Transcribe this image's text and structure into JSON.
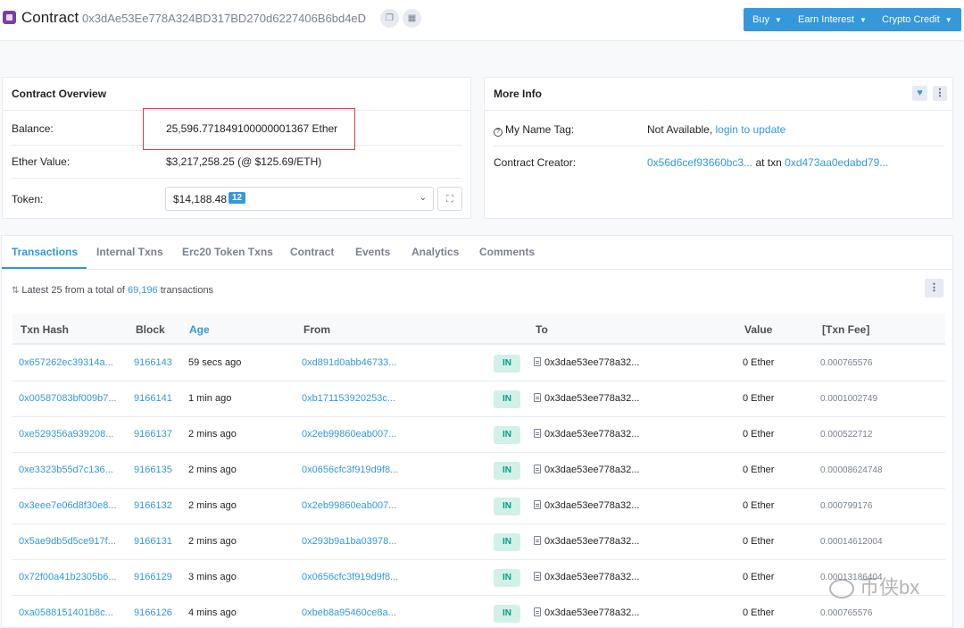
{
  "header": {
    "title": "Contract",
    "address": "0x3dAe53Ee778A324BD317BD270d6227406B6bd4eD",
    "buttons": [
      {
        "label": "Buy"
      },
      {
        "label": "Earn Interest"
      },
      {
        "label": "Crypto Credit"
      }
    ]
  },
  "overview": {
    "title": "Contract Overview",
    "balance_label": "Balance:",
    "balance_value": "25,596.771849100000001367 Ether",
    "ether_value_label": "Ether Value:",
    "ether_value": "$3,217,258.25 (@ $125.69/ETH)",
    "token_label": "Token:",
    "token_value": "$14,188.48",
    "token_count": "12"
  },
  "more_info": {
    "title": "More Info",
    "name_tag_label": "My Name Tag:",
    "name_tag_value": "Not Available,",
    "name_tag_link": "login to update",
    "creator_label": "Contract Creator:",
    "creator_address": "0x56d6cef93660bc3...",
    "creator_at": "at txn",
    "creator_txn": "0xd473aa0edabd79..."
  },
  "tabs": [
    {
      "label": "Transactions",
      "active": true
    },
    {
      "label": "Internal Txns"
    },
    {
      "label": "Erc20 Token Txns"
    },
    {
      "label": "Contract"
    },
    {
      "label": "Events"
    },
    {
      "label": "Analytics"
    },
    {
      "label": "Comments"
    }
  ],
  "summary": {
    "prefix": "Latest 25 from a total of",
    "total": "69,196",
    "suffix": "transactions"
  },
  "table": {
    "headers": [
      "Txn Hash",
      "Block",
      "Age",
      "From",
      "To",
      "Value",
      "[Txn Fee]"
    ],
    "rows": [
      {
        "hash": "0x657262ec39314a...",
        "block": "9166143",
        "age": "59 secs ago",
        "from": "0xd891d0abb46733...",
        "dir": "IN",
        "to": "0x3dae53ee778a32...",
        "value": "0 Ether",
        "fee": "0.000765576"
      },
      {
        "hash": "0x00587083bf009b7...",
        "block": "9166141",
        "age": "1 min ago",
        "from": "0xb171153920253c...",
        "dir": "IN",
        "to": "0x3dae53ee778a32...",
        "value": "0 Ether",
        "fee": "0.0001002749"
      },
      {
        "hash": "0xe529356a939208...",
        "block": "9166137",
        "age": "2 mins ago",
        "from": "0x2eb99860eab007...",
        "dir": "IN",
        "to": "0x3dae53ee778a32...",
        "value": "0 Ether",
        "fee": "0.000522712"
      },
      {
        "hash": "0xe3323b55d7c136...",
        "block": "9166135",
        "age": "2 mins ago",
        "from": "0x0656cfc3f919d9f8...",
        "dir": "IN",
        "to": "0x3dae53ee778a32...",
        "value": "0 Ether",
        "fee": "0.00008624748"
      },
      {
        "hash": "0x3eee7e06d8f30e8...",
        "block": "9166132",
        "age": "2 mins ago",
        "from": "0x2eb99860eab007...",
        "dir": "IN",
        "to": "0x3dae53ee778a32...",
        "value": "0 Ether",
        "fee": "0.000799176"
      },
      {
        "hash": "0x5ae9db5d5ce917f...",
        "block": "9166131",
        "age": "2 mins ago",
        "from": "0x293b9a1ba03978...",
        "dir": "IN",
        "to": "0x3dae53ee778a32...",
        "value": "0 Ether",
        "fee": "0.00014612004"
      },
      {
        "hash": "0x72f00a41b2305b6...",
        "block": "9166129",
        "age": "3 mins ago",
        "from": "0x0656cfc3f919d9f8...",
        "dir": "IN",
        "to": "0x3dae53ee778a32...",
        "value": "0 Ether",
        "fee": "0.00013186404"
      },
      {
        "hash": "0xa0588151401b8c...",
        "block": "9166126",
        "age": "4 mins ago",
        "from": "0xbeb8a95460ce8a...",
        "dir": "IN",
        "to": "0x3dae53ee778a32...",
        "value": "0 Ether",
        "fee": "0.000765576"
      }
    ]
  },
  "watermark": "币侠bx"
}
